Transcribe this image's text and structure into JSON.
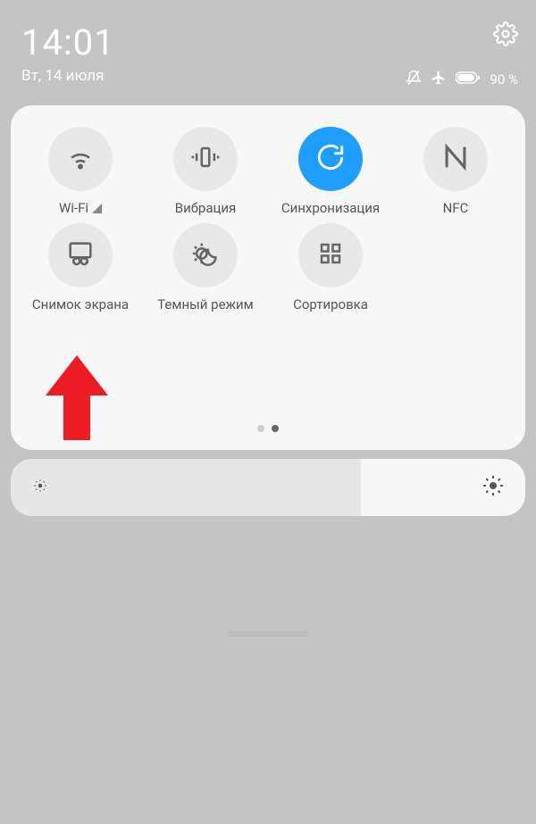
{
  "status": {
    "time": "14:01",
    "date": "Вт, 14 июля",
    "battery": "90 %"
  },
  "tiles": [
    {
      "label": "Wi-Fi",
      "icon": "wifi-icon",
      "active": false,
      "showSignal": true
    },
    {
      "label": "Вибрация",
      "icon": "vibration-icon",
      "active": false
    },
    {
      "label": "Синхронизация",
      "icon": "sync-icon",
      "active": true
    },
    {
      "label": "NFC",
      "icon": "nfc-icon",
      "active": false
    },
    {
      "label": "Снимок экрана",
      "icon": "screenshot-icon",
      "active": false
    },
    {
      "label": "Темный режим",
      "icon": "dark-mode-icon",
      "active": false
    },
    {
      "label": "Сортировка",
      "icon": "sort-icon",
      "active": false
    }
  ]
}
